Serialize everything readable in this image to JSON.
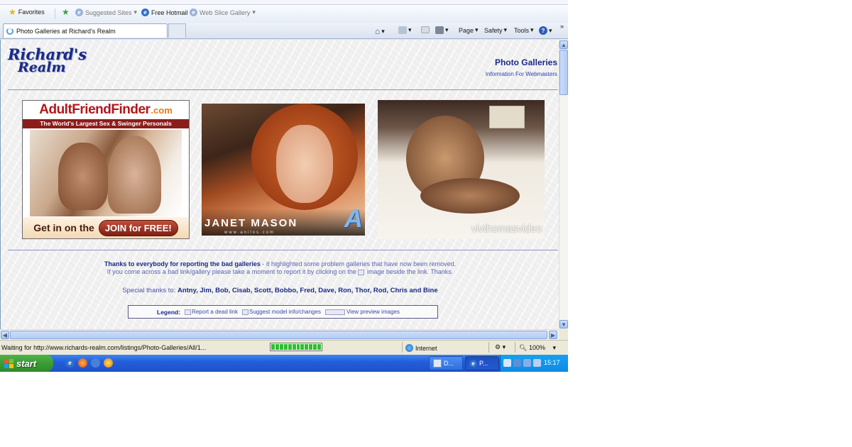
{
  "browser": {
    "favorites_bar": {
      "favorites_label": "Favorites",
      "items": [
        {
          "label": "Suggested Sites",
          "dimmed": true
        },
        {
          "label": "Free Hotmail",
          "dimmed": false
        },
        {
          "label": "Web Slice Gallery",
          "dimmed": true
        }
      ]
    },
    "tab": {
      "title": "Photo Galleries at Richard's Realm"
    },
    "command_bar": {
      "page_label": "Page",
      "safety_label": "Safety",
      "tools_label": "Tools",
      "help_label": "?",
      "more": "»"
    },
    "status_bar": {
      "text": "Waiting for http://www.richards-realm.com/listings/Photo-Galleries/All/1...",
      "progress_blocks": 12,
      "zone": "Internet",
      "zoom": "100%"
    }
  },
  "page": {
    "logo": {
      "line1": "Richard's",
      "line2": "Realm"
    },
    "title": "Photo Galleries",
    "subtitle": "Information For Webmasters",
    "ads": {
      "ad1": {
        "brand_main": "AdultFriendFinder",
        "brand_tld": ".com",
        "tagline": "The World's Largest Sex & Swinger Personals Community",
        "cta_text": "Get in on the",
        "cta_button": "JOIN for FREE!"
      },
      "ad2": {
        "name": "JANET MASON",
        "url": "www.anilos.com"
      },
      "ad3": {
        "watermark": "vivthomasvideo"
      }
    },
    "thanks": {
      "bold": "Thanks to everybody for reporting the bad galleries",
      "rest": " - it highlighted some problem galleries that have now been removed.",
      "line2_a": "If you come across a bad link/gallery please take a moment to report it by clicking on the",
      "line2_b": "image beside the link. Thanks."
    },
    "special": {
      "label": "Special thanks to:",
      "names": "Antny, Jim, Bob, Cisab, Scott, Bobbo, Fred, Dave, Ron, Thor, Rod, Chris and Bine"
    },
    "legend": {
      "label": "Legend:",
      "items": [
        "Report a dead link",
        "Suggest model info/changes",
        "View preview images"
      ]
    }
  },
  "taskbar": {
    "start_label": "start",
    "buttons": [
      {
        "label": "D...",
        "active": false
      },
      {
        "label": "P...",
        "active": true
      }
    ],
    "clock": "15:17"
  }
}
